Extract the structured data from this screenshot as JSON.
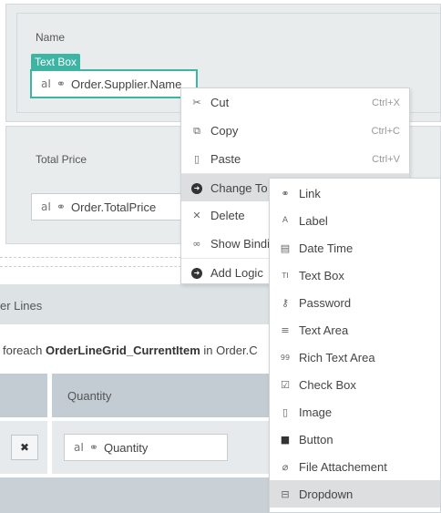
{
  "form": {
    "name_label": "Name",
    "textbox_tag": "Text Box",
    "name_value": "Order.Supplier.Name",
    "total_label": "Total Price",
    "total_value": "Order.TotalPrice"
  },
  "section": {
    "title_partial": "er Lines",
    "foreach_prefix": "foreach",
    "foreach_item": "OrderLineGrid_CurrentItem",
    "foreach_suffix": "in Order.C",
    "col_quantity": "Quantity",
    "remove_glyph": "✖",
    "quantity_value": "Quantity"
  },
  "context_menu": {
    "items": [
      {
        "label": "Cut",
        "shortcut": "Ctrl+X",
        "icon": "cut-icon",
        "glyph": "✂"
      },
      {
        "label": "Copy",
        "shortcut": "Ctrl+C",
        "icon": "copy-icon",
        "glyph": "⧉"
      },
      {
        "label": "Paste",
        "shortcut": "Ctrl+V",
        "icon": "paste-icon",
        "glyph": "▯"
      },
      {
        "label": "Change To",
        "shortcut": "",
        "icon": "arrow-right-circle-icon",
        "glyph": "➜"
      },
      {
        "label": "Delete",
        "shortcut": "",
        "icon": "close-icon",
        "glyph": "✕"
      },
      {
        "label": "Show Bindi",
        "shortcut": "",
        "icon": "binoculars-icon",
        "glyph": "∞"
      },
      {
        "label": "Add Logic",
        "shortcut": "",
        "icon": "arrow-right-circle-icon",
        "glyph": "➜"
      }
    ]
  },
  "submenu": {
    "items": [
      {
        "label": "Link",
        "icon": "link-icon",
        "glyph": "⚭"
      },
      {
        "label": "Label",
        "icon": "label-icon",
        "glyph": "A"
      },
      {
        "label": "Date Time",
        "icon": "calendar-icon",
        "glyph": "▤"
      },
      {
        "label": "Text Box",
        "icon": "textbox-icon",
        "glyph": "TI"
      },
      {
        "label": "Password",
        "icon": "key-icon",
        "glyph": "⚷"
      },
      {
        "label": "Text Area",
        "icon": "textarea-icon",
        "glyph": "≡"
      },
      {
        "label": "Rich Text Area",
        "icon": "richtext-icon",
        "glyph": "99"
      },
      {
        "label": "Check Box",
        "icon": "checkbox-icon",
        "glyph": "☑"
      },
      {
        "label": "Image",
        "icon": "image-icon",
        "glyph": "▯"
      },
      {
        "label": "Button",
        "icon": "button-icon",
        "glyph": "■"
      },
      {
        "label": "File Attachement",
        "icon": "paperclip-icon",
        "glyph": "⌀"
      },
      {
        "label": "Dropdown",
        "icon": "dropdown-icon",
        "glyph": "⊟"
      }
    ]
  },
  "colors": {
    "accent": "#3db4a4",
    "panel": "#e9eced",
    "grid_header": "#c2ccd2",
    "menu_highlight": "#dcdedf"
  }
}
